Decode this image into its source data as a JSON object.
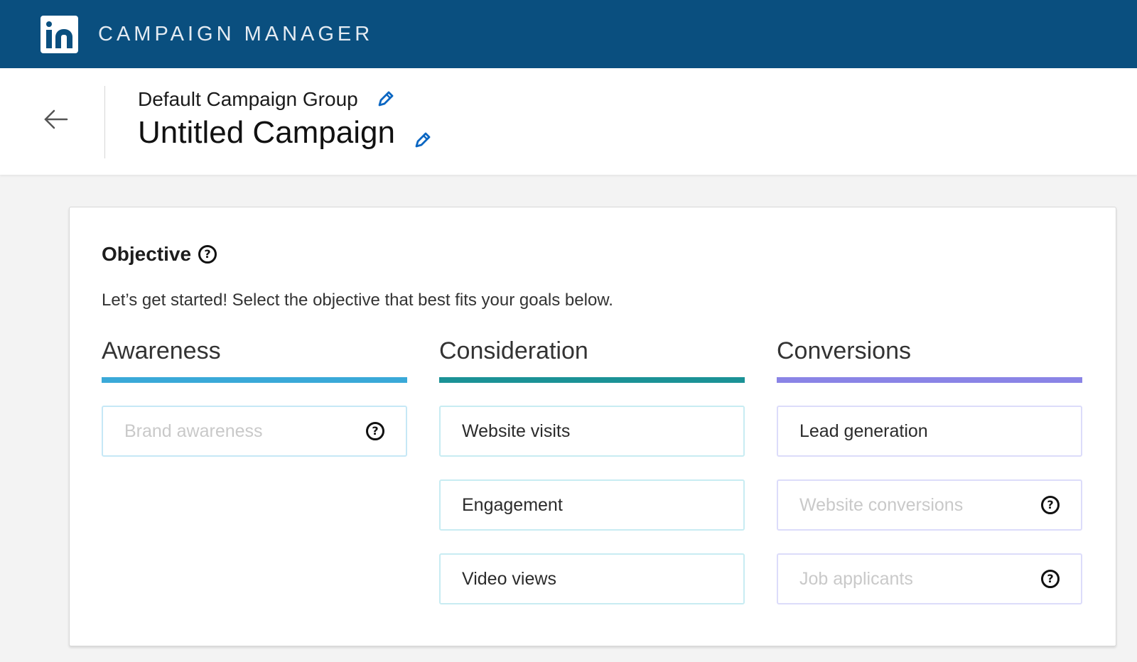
{
  "app": {
    "title": "CAMPAIGN MANAGER",
    "logo_text": "in"
  },
  "header": {
    "campaign_group": "Default Campaign Group",
    "campaign_name": "Untitled Campaign"
  },
  "objective": {
    "title": "Objective",
    "intro": "Let’s get started! Select the objective that best fits your goals below.",
    "columns": [
      {
        "title": "Awareness",
        "color": "#3aa9d8",
        "border_color": "#c6e8f6",
        "options": [
          {
            "label": "Brand awareness",
            "disabled": true,
            "help": true
          }
        ]
      },
      {
        "title": "Consideration",
        "color": "#1b9296",
        "border_color": "#c8ecf2",
        "options": [
          {
            "label": "Website visits",
            "disabled": false,
            "help": false
          },
          {
            "label": "Engagement",
            "disabled": false,
            "help": false
          },
          {
            "label": "Video views",
            "disabled": false,
            "help": false
          }
        ]
      },
      {
        "title": "Conversions",
        "color": "#8a84e6",
        "border_color": "#dcdcfa",
        "options": [
          {
            "label": "Lead generation",
            "disabled": false,
            "help": false
          },
          {
            "label": "Website conversions",
            "disabled": true,
            "help": true
          },
          {
            "label": "Job applicants",
            "disabled": true,
            "help": true
          }
        ]
      }
    ]
  }
}
